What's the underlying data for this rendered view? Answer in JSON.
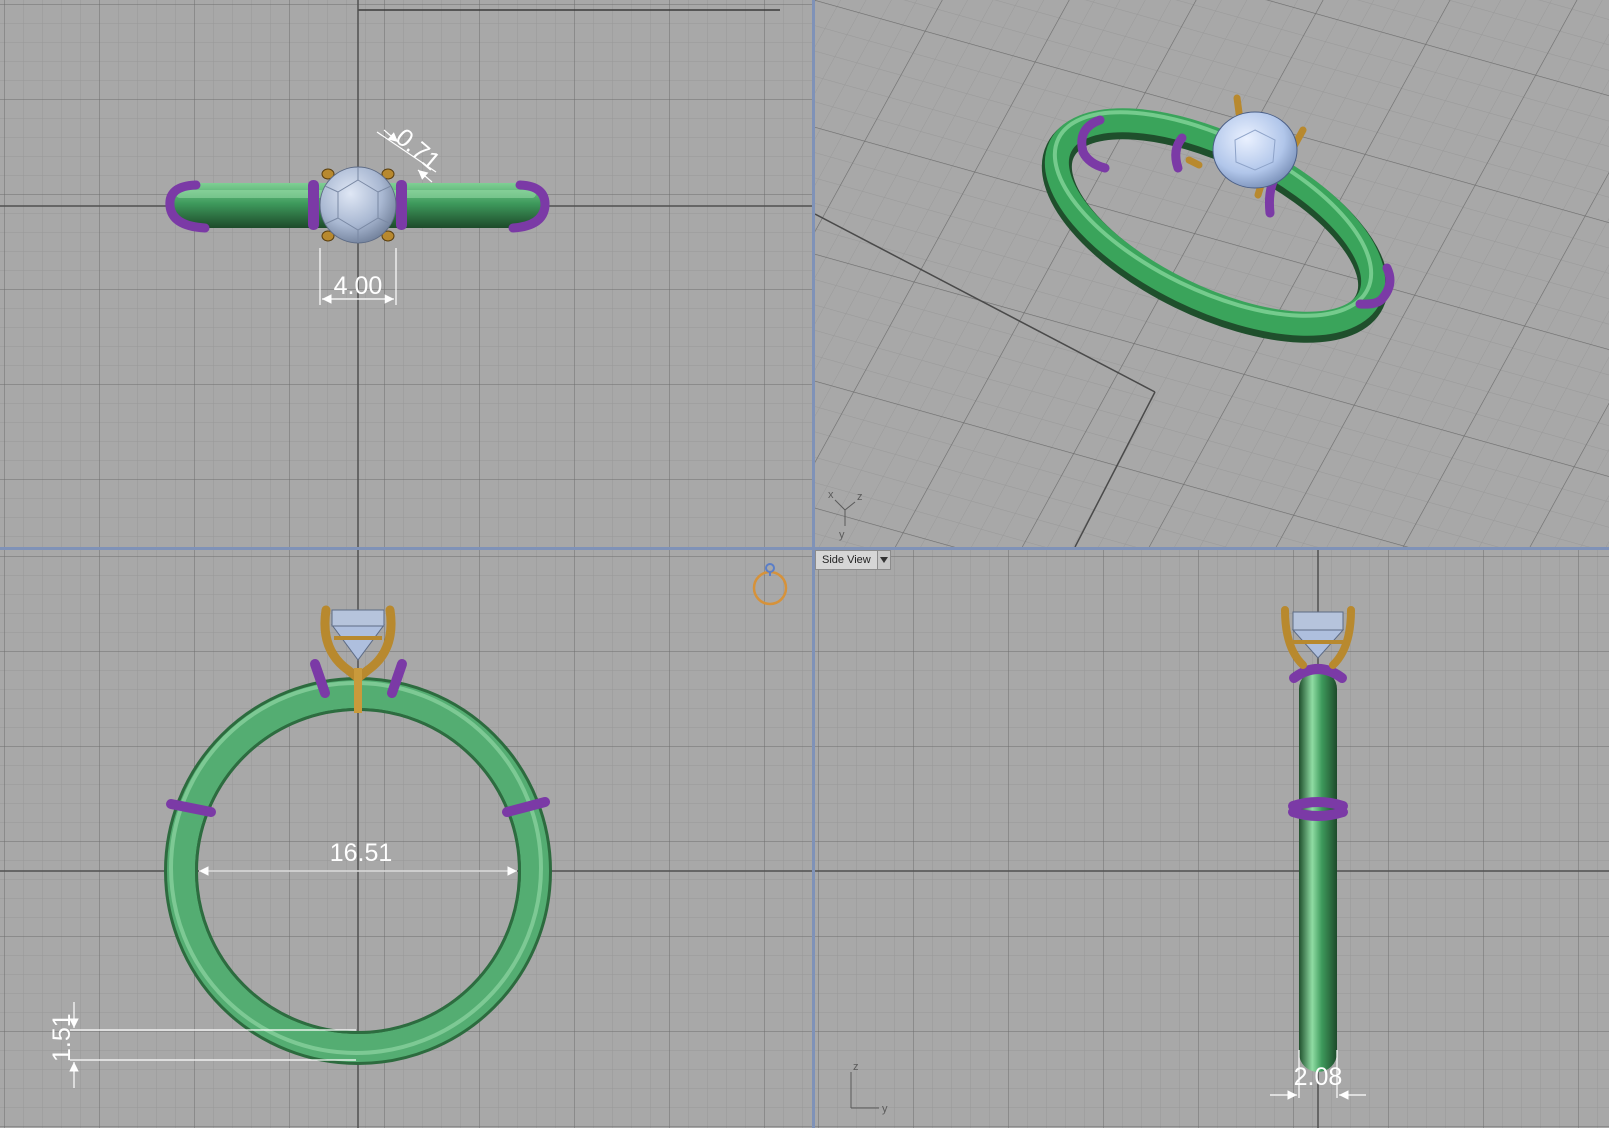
{
  "viewports": {
    "top": {
      "dims": {
        "prong": "0.71",
        "stone_width": "4.00"
      }
    },
    "perspective": {
      "axis": {
        "x": "x",
        "y": "y",
        "z": "z"
      }
    },
    "front": {
      "dims": {
        "inner_diameter": "16.51",
        "band_thickness": "1.51"
      }
    },
    "side": {
      "view_label": "Side View",
      "axis": {
        "z": "z",
        "y": "y"
      },
      "dims": {
        "band_width": "2.08"
      }
    }
  },
  "colors": {
    "band": "#3a9a5a",
    "band_highlight": "#8fdca3",
    "band_shadow": "#1f4f2c",
    "bead": "#7b3aa6",
    "prong": "#b8892e",
    "stone": "#aebfde",
    "grid_minor": "#9a9a9a",
    "grid_major": "#707070",
    "dimension": "#ffffff"
  },
  "icons": {
    "view_widget": "ring-view-widget-icon",
    "dropdown": "chevron-down-icon"
  }
}
